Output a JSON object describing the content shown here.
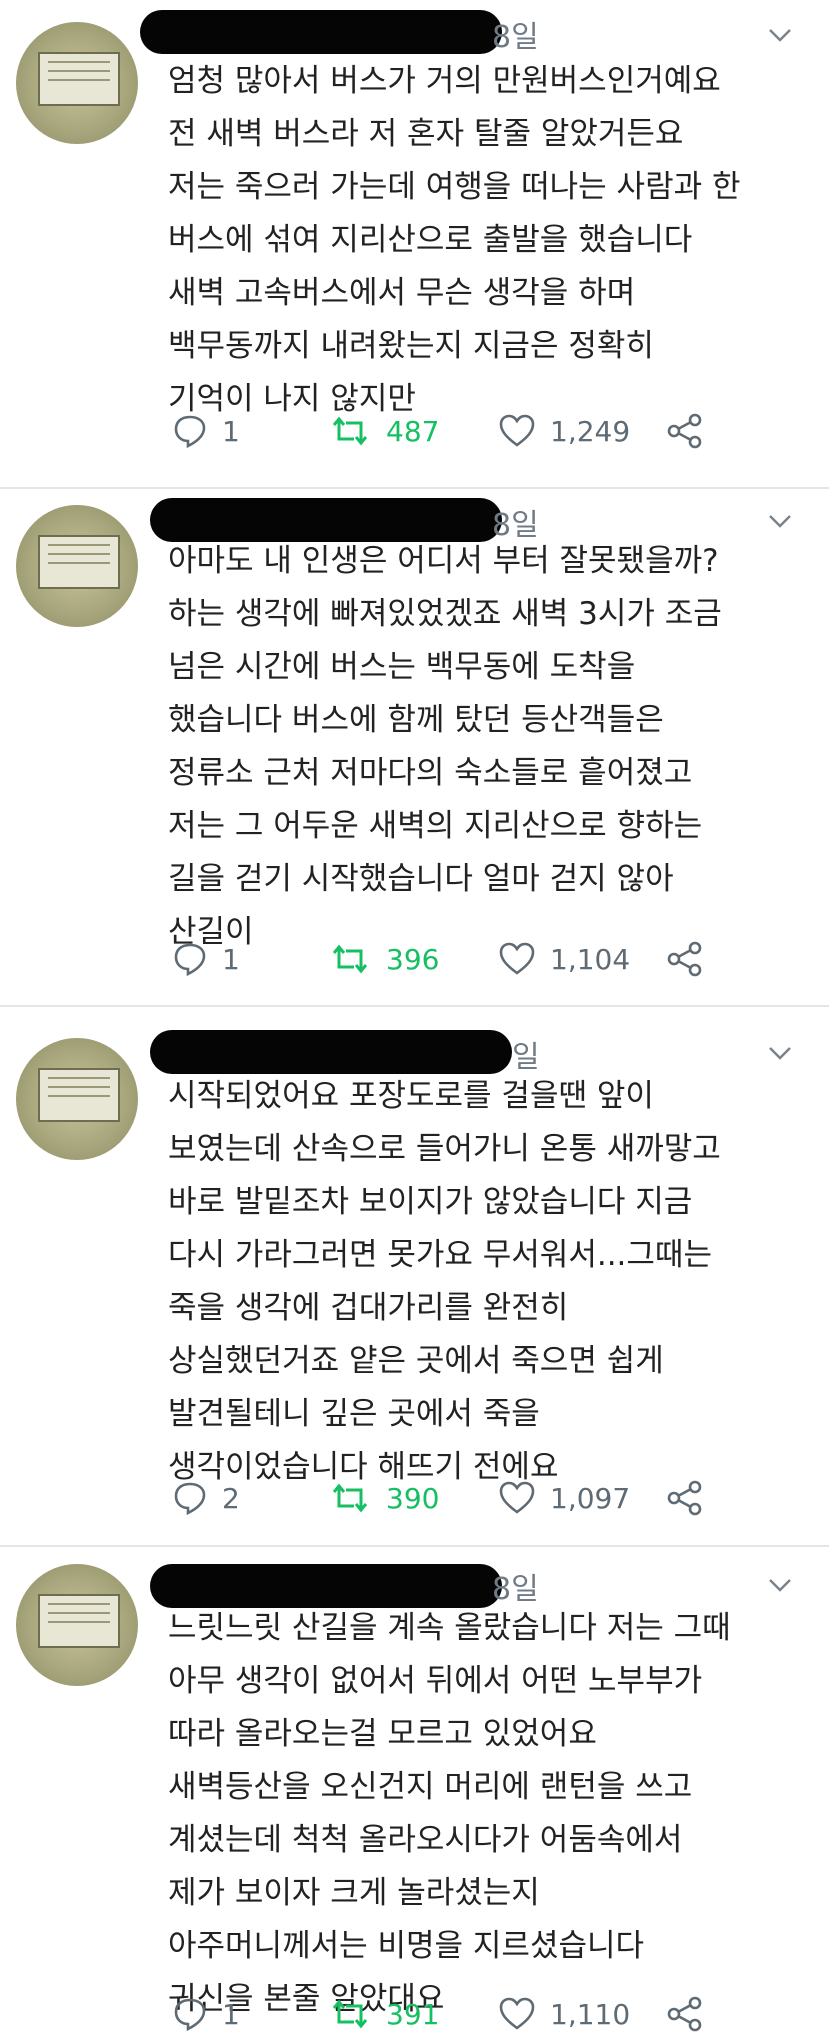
{
  "tweets": [
    {
      "date": "8일",
      "lines": [
        "엄청 많아서 버스가 거의 만원버스인거예요",
        "전 새벽 버스라 저 혼자 탈줄 알았거든요",
        "저는 죽으러 가는데 여행을 떠나는 사람과 한",
        "버스에 섞여 지리산으로 출발을 했습니다",
        "새벽 고속버스에서 무슨 생각을 하며",
        "백무동까지 내려왔는지 지금은 정확히",
        "기억이 나지 않지만"
      ],
      "replies": "1",
      "retweets": "487",
      "likes": "1,249"
    },
    {
      "date": "8일",
      "lines": [
        "아마도 내 인생은 어디서 부터 잘못됐을까?",
        "하는 생각에 빠져있었겠죠 새벽 3시가 조금",
        "넘은 시간에 버스는 백무동에 도착을",
        "했습니다 버스에 함께 탔던 등산객들은",
        "정류소 근처 저마다의 숙소들로 흩어졌고",
        "저는 그 어두운 새벽의 지리산으로 향하는",
        "길을 걷기 시작했습니다 얼마 걷지 않아",
        "산길이"
      ],
      "replies": "1",
      "retweets": "396",
      "likes": "1,104"
    },
    {
      "date": "일",
      "lines": [
        "시작되었어요 포장도로를 걸을땐 앞이",
        "보였는데 산속으로 들어가니 온통 새까맣고",
        "바로 발밑조차 보이지가 않았습니다 지금",
        "다시 가라그러면 못가요 무서워서...그때는",
        "죽을 생각에 겁대가리를 완전히",
        "상실했던거죠 얕은 곳에서 죽으면 쉽게",
        "발견될테니 깊은 곳에서 죽을",
        "생각이었습니다 해뜨기 전에요"
      ],
      "replies": "2",
      "retweets": "390",
      "likes": "1,097"
    },
    {
      "date": "8일",
      "lines": [
        "느릿느릿 산길을 계속 올랐습니다 저는 그때",
        "아무 생각이 없어서 뒤에서 어떤 노부부가",
        "따라 올라오는걸 모르고 있었어요",
        "새벽등산을 오신건지 머리에 랜턴을 쓰고",
        "계셨는데 척척 올라오시다가 어둠속에서",
        "제가 보이자 크게 놀라셨는지",
        "아주머니께서는 비명을 지르셨습니다",
        "귀신을 본줄 알았대요"
      ],
      "replies": "1",
      "retweets": "391",
      "likes": "1,110"
    }
  ]
}
